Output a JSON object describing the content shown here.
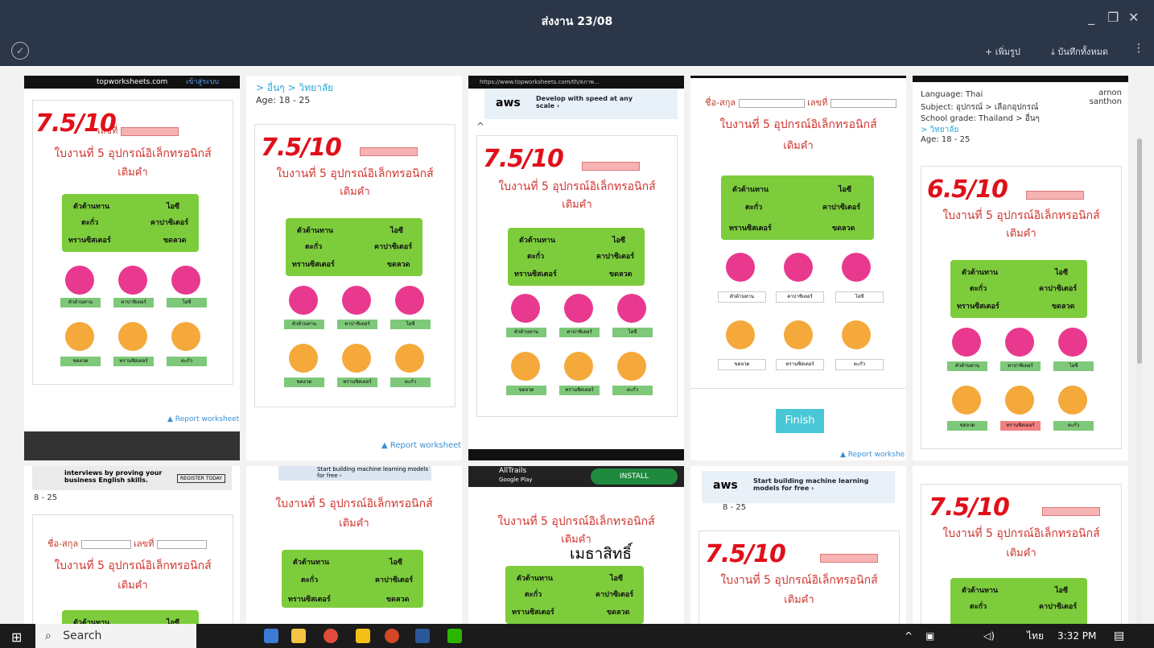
{
  "window": {
    "title": "ส่งงาน 23/08",
    "minimize": "_",
    "restore": "❐",
    "close": "✕"
  },
  "toolbar": {
    "add_label": "+ เพิ่มรูป",
    "save_all_label": "⤓ บันทึกทั้งหมด",
    "more_label": "⋮"
  },
  "worksheet": {
    "name_label": "ชื่อ-สกุล",
    "number_label": "เลขที่",
    "title": "ใบงานที่ 5 อุปกรณ์อิเล็กทรอนิกส์",
    "subtitle": "เติมคำ",
    "box_left": [
      "ตัวต้านทาน",
      "ตะกั่ว",
      "ทรานซิสเตอร์"
    ],
    "box_right": [
      "ไอซี",
      "คาปาซิเตอร์",
      "ขดลวด"
    ],
    "labels_row1": [
      "ตัวต้านทาน",
      "คาปาซิเตอร์",
      "ไอซี"
    ],
    "labels_row2": [
      "ขดลวด",
      "ทรานซิสเตอร์",
      "ตะกั่ว"
    ],
    "report": "▲ Report worksheet"
  },
  "tiles": [
    {
      "score": "7.5/10",
      "url": "topworksheets.com",
      "url_extra": "เข้าสู่ระบบ"
    },
    {
      "score": "7.5/10",
      "breadcrumb": "> อื่นๆ > วิทยาลัย",
      "age": "Age: 18 - 25"
    },
    {
      "score": "7.5/10",
      "url": "https://www.topworksheets.com/th/สภาพ...",
      "ad_text": "Develop with speed at any scale ›"
    },
    {
      "score": "",
      "finish": "Finish",
      "report": "▲ Report workshe"
    },
    {
      "score": "6.5/10",
      "meta_language": "Language: Thai",
      "meta_subject": "Subject: อุปกรณ์ > เลือกอุปกรณ์",
      "meta_grade": "School grade: Thailand > อื่นๆ",
      "meta_grade2": "> วิทยาลัย",
      "meta_age": "Age: 18 - 25",
      "user": "arnon santhon"
    },
    {
      "ad_text": "interviews by proving your business English skills.",
      "ad_button": "REGISTER TODAY",
      "age": "8 - 25"
    },
    {
      "ad_text": "Start building machine learning models for free ›"
    },
    {
      "ad_app": "AllTrails",
      "ad_store": "Google Play",
      "install": "INSTALL",
      "handwriting": "เมธาสิทธิ์"
    },
    {
      "score": "7.5/10",
      "ad_text": "Start building machine learning models for free ›",
      "age": "8 - 25"
    },
    {
      "score": "7.5/10"
    }
  ],
  "taskbar": {
    "search": "Search",
    "lang": "ไทย",
    "time": "3:32 PM"
  }
}
